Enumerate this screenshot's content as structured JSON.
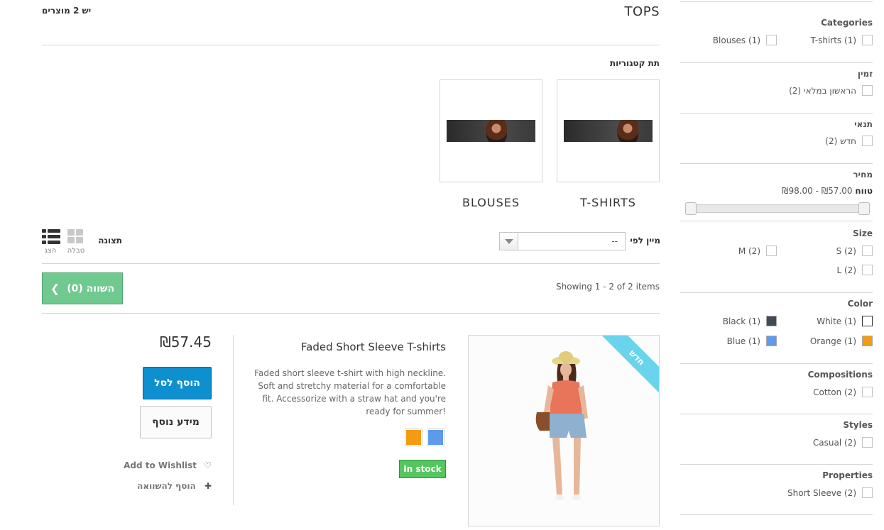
{
  "category": {
    "title": "TOPS",
    "product_count": "יש 2 מוצרים",
    "subcategories_heading": "תת קטגוריות",
    "subcategories": [
      {
        "name": "T-SHIRTS"
      },
      {
        "name": "BLOUSES"
      }
    ]
  },
  "toolbar": {
    "sort_label": "מיין לפי",
    "sort_value": "--",
    "view_label": "תצוגה",
    "view_grid": "טבלה",
    "view_list": "הצג",
    "showing": "Showing 1 - 2 of 2 items",
    "compare_label": "השווה (0)"
  },
  "product": {
    "name": "Faded Short Sleeve T-shirts",
    "ribbon": "חדש",
    "description": "Faded short sleeve t-shirt with high neckline. Soft and stretchy material for a comfortable fit. Accessorize with a straw hat and you're ready for summer!",
    "price": "₪57.45",
    "availability": "In stock",
    "add_to_cart": "הוסף לסל",
    "more_info": "מידע נוסף",
    "wishlist": "Add to Wishlist",
    "add_compare": "הוסף להשוואה",
    "swatches": [
      "#5b9bea",
      "#f39c11"
    ]
  },
  "filters": {
    "categories": {
      "title": "Categories",
      "opt1": "T-shirts (1)",
      "opt2": "Blouses (1)"
    },
    "availability": {
      "title": "זמין",
      "opt1": "הראשון במלאי (2)"
    },
    "condition": {
      "title": "תנאי",
      "opt1": "חדש (2)"
    },
    "price": {
      "title": "מחיר",
      "range_label": "טווח",
      "range": "₪57.00 - ₪98.00"
    },
    "size": {
      "title": "Size",
      "s": "S (2)",
      "m": "M (2)",
      "l": "L (2)"
    },
    "color": {
      "title": "Color",
      "white": "White (1)",
      "black": "Black (1)",
      "orange": "Orange (1)",
      "blue": "Blue (1)",
      "white_hex": "#ffffff",
      "black_hex": "#434a54",
      "orange_hex": "#f39c11",
      "blue_hex": "#5d9cec"
    },
    "compositions": {
      "title": "Compositions",
      "opt1": "Cotton (2)"
    },
    "styles": {
      "title": "Styles",
      "opt1": "Casual (2)"
    },
    "properties": {
      "title": "Properties",
      "opt1": "Short Sleeve (2)"
    }
  }
}
